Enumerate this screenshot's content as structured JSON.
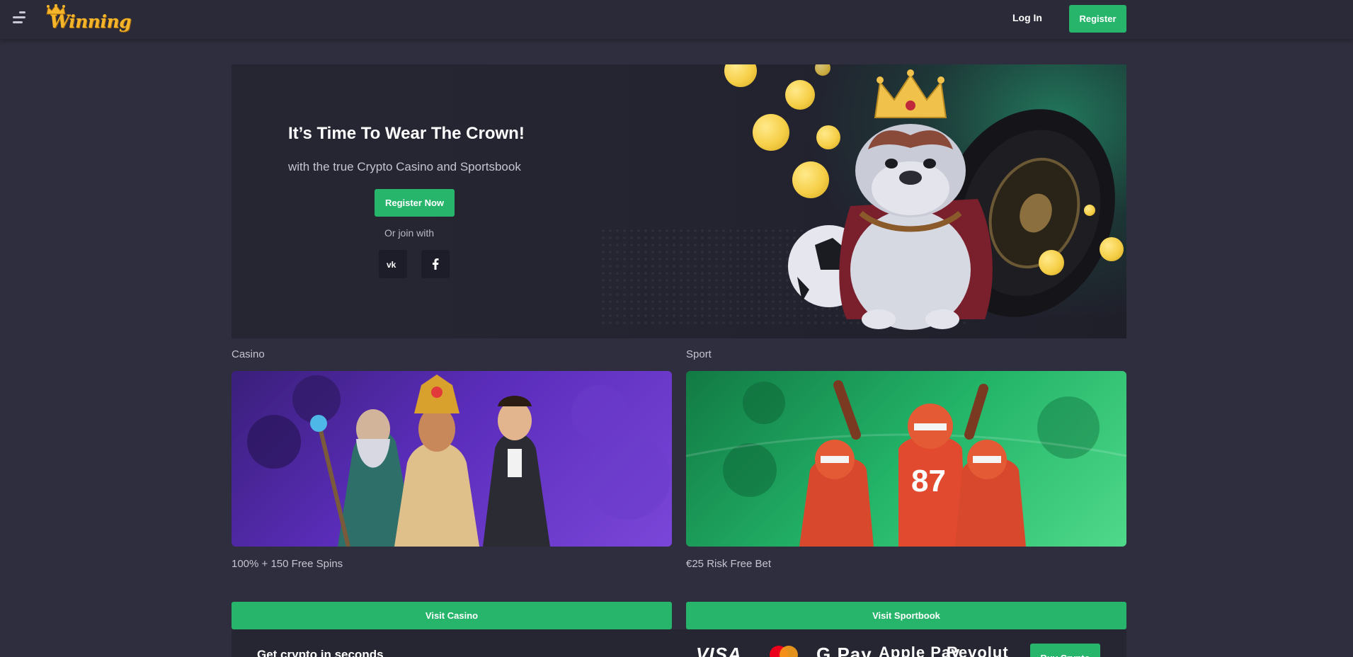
{
  "header": {
    "logo_text": "Winning",
    "login_label": "Log In",
    "register_label": "Register"
  },
  "hero": {
    "title": "It’s Time To Wear The Crown!",
    "subtitle": "with the true Crypto Casino and Sportsbook",
    "cta_label": "Register Now",
    "or_join_label": "Or join with",
    "social": [
      {
        "name": "vk",
        "glyph": "vk"
      },
      {
        "name": "facebook",
        "glyph": "f"
      }
    ]
  },
  "sections": {
    "casino": {
      "label": "Casino",
      "offer": "100% + 150 Free Spins",
      "button_label": "Visit Casino"
    },
    "sport": {
      "label": "Sport",
      "offer": "€25 Risk Free Bet",
      "button_label": "Visit Sportbook"
    }
  },
  "crypto": {
    "title": "Get crypto in seconds",
    "payment_methods": [
      "VISA",
      "mastercard",
      "G Pay",
      "Apple Pay",
      "Revolut"
    ],
    "buy_label": "Buy Crypto"
  },
  "colors": {
    "accent": "#26b56b",
    "page_bg": "#2e2e3e",
    "header_bg": "#2a2a39",
    "panel_bg": "#262633",
    "logo_gold": "#f4b52b"
  }
}
